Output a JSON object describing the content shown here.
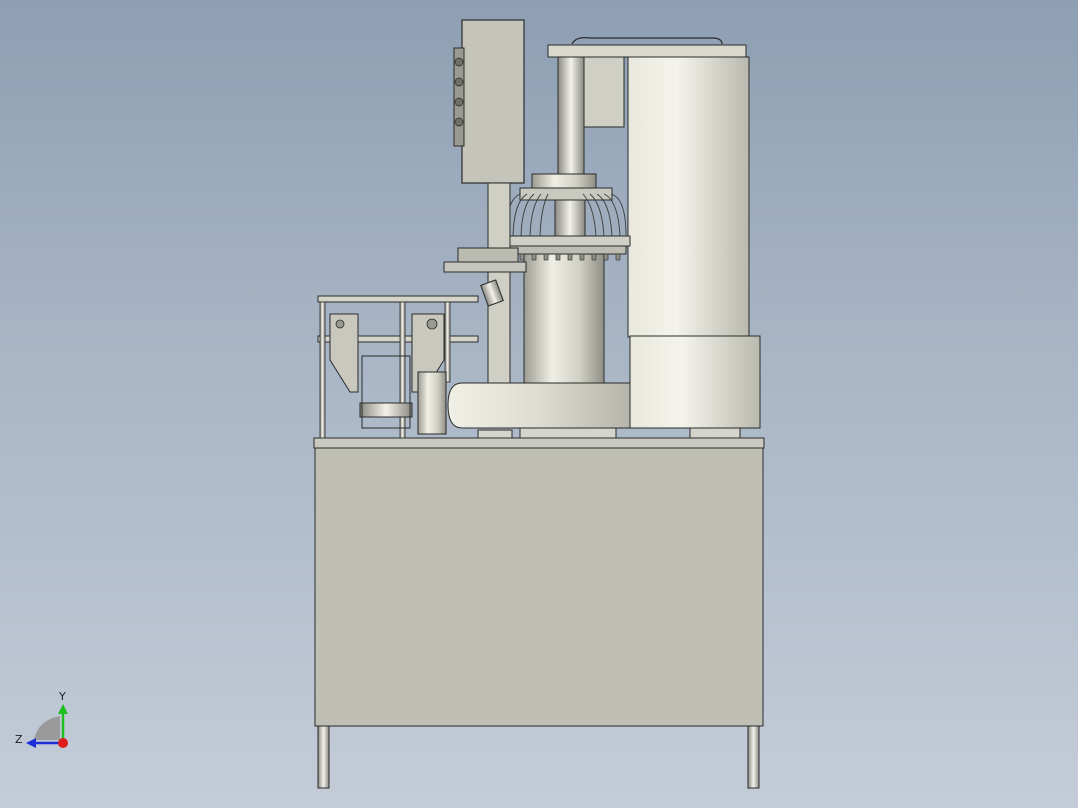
{
  "viewport": {
    "background_top": "#8e9fb3",
    "background_bottom": "#c4ccd8"
  },
  "triad": {
    "y_label": "Y",
    "z_label": "Z",
    "y_axis_color": "#1fbf1f",
    "z_axis_color": "#1a2fd6",
    "x_axis_color": "#e01b1b"
  },
  "model": {
    "body_color": "#bfbfb5",
    "metal_color": "#d9d9cf",
    "edge_color": "#2b2b2b"
  }
}
